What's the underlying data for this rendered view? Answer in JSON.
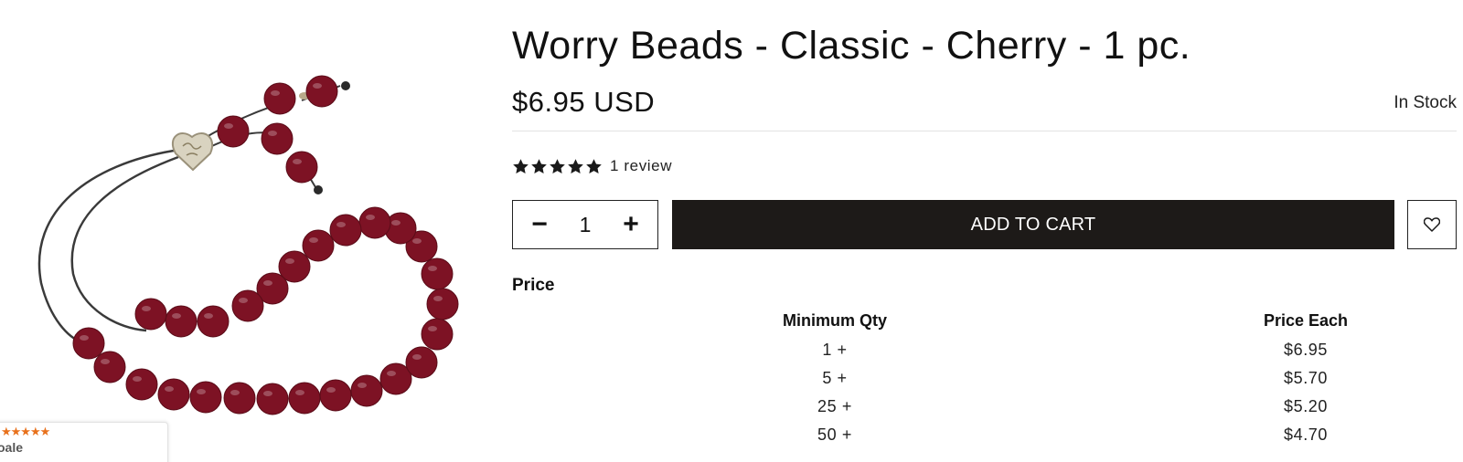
{
  "product": {
    "title": "Worry Beads - Classic - Cherry - 1 pc.",
    "price": "$6.95 USD",
    "stock_status": "In Stock",
    "rating": 5,
    "review_text": "1 review",
    "image_alt": "Cherry worry beads"
  },
  "cart": {
    "quantity": "1",
    "minus_label": "−",
    "plus_label": "+",
    "add_to_cart_label": "ADD TO CART",
    "wishlist_icon": "heart-icon"
  },
  "pricing": {
    "section_label": "Price",
    "headers": {
      "min_qty": "Minimum Qty",
      "price_each": "Price Each"
    },
    "tiers": [
      {
        "min_qty": "1 +",
        "price_each": "$6.95"
      },
      {
        "min_qty": "5 +",
        "price_each": "$5.70"
      },
      {
        "min_qty": "25 +",
        "price_each": "$5.20"
      },
      {
        "min_qty": "50 +",
        "price_each": "$4.70"
      }
    ]
  },
  "google_badge": {
    "stars": "★★★★★",
    "text": "oale"
  },
  "colors": {
    "bead": "#7d1224",
    "button_bg": "#1d1a18",
    "star": "#1a1a1a",
    "google_star": "#e8711c"
  }
}
